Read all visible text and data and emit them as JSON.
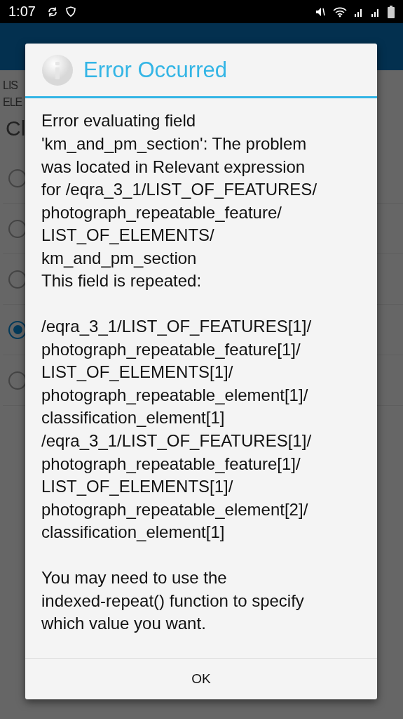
{
  "status_bar": {
    "time": "1:07"
  },
  "background": {
    "labels": [
      "LIS",
      "ELE"
    ],
    "heading": "Cl",
    "radios": [
      {
        "selected": false
      },
      {
        "selected": false
      },
      {
        "selected": false
      },
      {
        "selected": true
      },
      {
        "selected": false
      }
    ]
  },
  "dialog": {
    "title": "Error Occurred",
    "paragraphs": [
      "Error evaluating field\n'km_and_pm_section': The problem\nwas located in Relevant expression\nfor /eqra_3_1/LIST_OF_FEATURES/\nphotograph_repeatable_feature/\nLIST_OF_ELEMENTS/\nkm_and_pm_section\nThis field is repeated:",
      "/eqra_3_1/LIST_OF_FEATURES[1]/\nphotograph_repeatable_feature[1]/\nLIST_OF_ELEMENTS[1]/\nphotograph_repeatable_element[1]/\nclassification_element[1]\n/eqra_3_1/LIST_OF_FEATURES[1]/\nphotograph_repeatable_feature[1]/\nLIST_OF_ELEMENTS[1]/\nphotograph_repeatable_element[2]/\nclassification_element[1]",
      "You may need to use the\nindexed-repeat() function to specify\nwhich value you want."
    ],
    "buttons": [
      "OK"
    ]
  }
}
